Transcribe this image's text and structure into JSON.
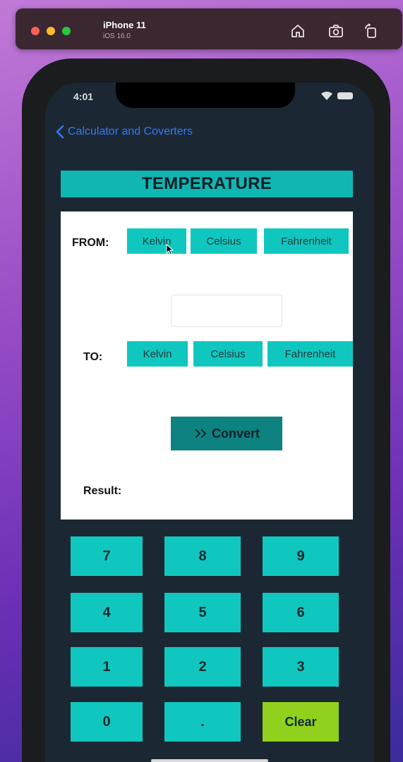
{
  "simulator": {
    "device": "iPhone 11",
    "os": "iOS 16.0"
  },
  "status_bar": {
    "time": "4:01"
  },
  "nav": {
    "back_label": "Calculator and Coverters"
  },
  "title": "TEMPERATURE",
  "from": {
    "label": "FROM:",
    "units": [
      "Kelvin",
      "Celsius",
      "Fahrenheit"
    ]
  },
  "to": {
    "label": "TO:",
    "units": [
      "Kelvin",
      "Celsius",
      "Fahrenheit"
    ]
  },
  "input": {
    "value": ""
  },
  "convert": {
    "label": "Convert"
  },
  "result": {
    "label": "Result:"
  },
  "keypad": {
    "keys": [
      "7",
      "8",
      "9",
      "4",
      "5",
      "6",
      "1",
      "2",
      "3",
      "0",
      ".",
      "Clear"
    ]
  },
  "colors": {
    "accent": "#10c7c0",
    "title_bg": "#10b7b2",
    "convert_bg": "#0d8280",
    "clear_bg": "#8fd11d",
    "screen_bg": "#1b2833",
    "link": "#3478f6"
  }
}
